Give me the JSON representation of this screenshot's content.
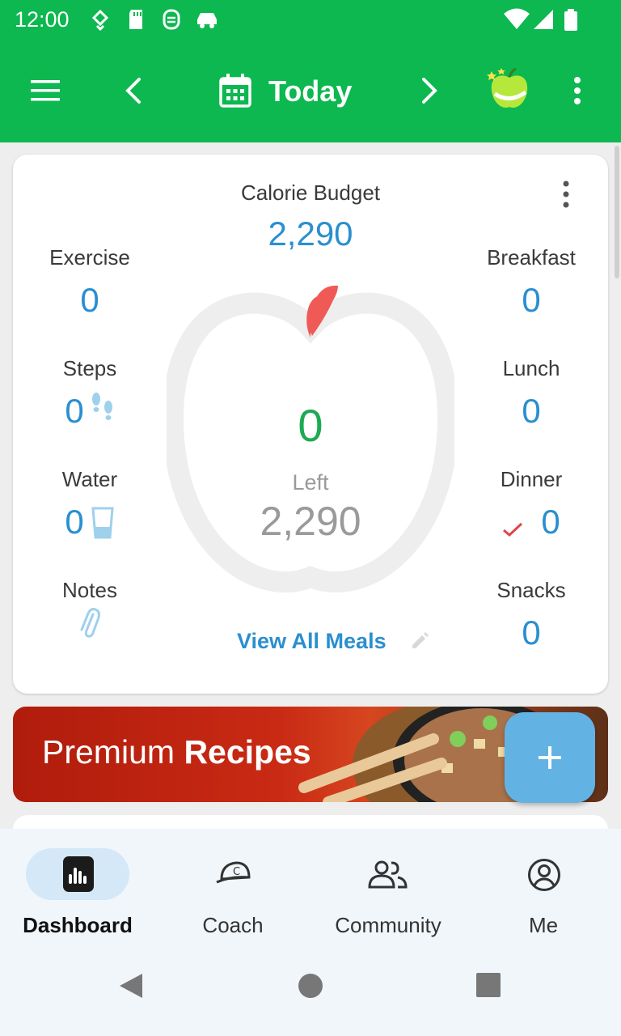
{
  "status_bar": {
    "time": "12:00"
  },
  "app_bar": {
    "title": "Today"
  },
  "card": {
    "calorie_budget_label": "Calorie Budget",
    "calorie_budget_value": "2,290",
    "left": {
      "exercise": {
        "label": "Exercise",
        "value": "0"
      },
      "steps": {
        "label": "Steps",
        "value": "0"
      },
      "water": {
        "label": "Water",
        "value": "0"
      },
      "notes": {
        "label": "Notes"
      }
    },
    "right": {
      "breakfast": {
        "label": "Breakfast",
        "value": "0"
      },
      "lunch": {
        "label": "Lunch",
        "value": "0"
      },
      "dinner": {
        "label": "Dinner",
        "value": "0"
      },
      "snacks": {
        "label": "Snacks",
        "value": "0"
      }
    },
    "center": {
      "eaten_value": "0",
      "left_label": "Left",
      "left_value": "2,290"
    },
    "view_all_meals": "View All Meals"
  },
  "banner": {
    "text_regular": "Premium",
    "text_bold": "Recipes"
  },
  "bottom_nav": {
    "items": [
      {
        "label": "Dashboard",
        "icon": "dashboard-icon",
        "active": true
      },
      {
        "label": "Coach",
        "icon": "coach-cap-icon",
        "active": false
      },
      {
        "label": "Community",
        "icon": "community-icon",
        "active": false
      },
      {
        "label": "Me",
        "icon": "profile-icon",
        "active": false
      }
    ]
  },
  "colors": {
    "primary_green": "#0cb84f",
    "value_blue": "#2a8fd0",
    "eaten_green": "#1daa52",
    "fab_blue": "#62b2e4"
  }
}
